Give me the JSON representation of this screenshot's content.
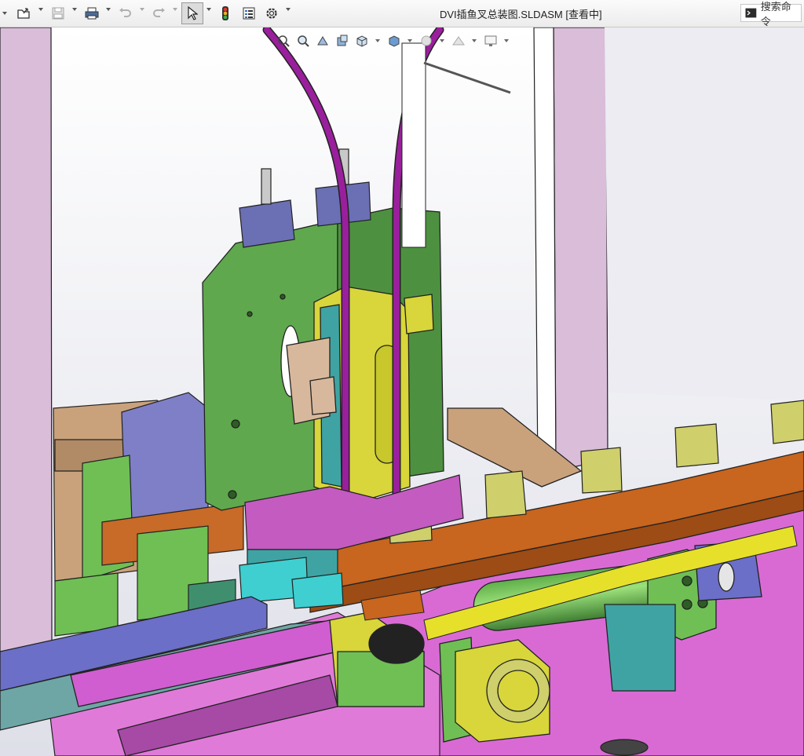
{
  "window": {
    "title": "DVI插鱼叉总装图.SLDASM [查看中]"
  },
  "toolbar": {
    "items": [
      {
        "name": "menu-arrow",
        "icon": "dropdown-arrow"
      },
      {
        "name": "open",
        "icon": "open-folder-icon"
      },
      {
        "name": "save",
        "icon": "save-icon"
      },
      {
        "name": "print",
        "icon": "print-icon"
      },
      {
        "name": "undo",
        "icon": "undo-icon"
      },
      {
        "name": "redo",
        "icon": "redo-icon"
      },
      {
        "name": "select",
        "icon": "cursor-icon"
      },
      {
        "name": "rebuild",
        "icon": "traffic-light-icon"
      },
      {
        "name": "file-properties",
        "icon": "properties-icon"
      },
      {
        "name": "options",
        "icon": "gear-icon"
      }
    ]
  },
  "search": {
    "label": "搜索命令",
    "icon": "search-command-icon"
  },
  "headsup_view": {
    "items": [
      "zoom-to-fit-icon",
      "zoom-area-icon",
      "previous-view-icon",
      "section-view-icon",
      "view-orientation-icon",
      "display-style-icon",
      "hide-show-icon",
      "appearance-icon",
      "scene-icon",
      "display-settings-icon"
    ]
  },
  "colors": {
    "background_top": "#ffffff",
    "background_bottom": "#e6e6ee",
    "green_plate": "#5fa84e",
    "yellow_part": "#d8d63a",
    "orange_rail": "#c8651e",
    "magenta_base": "#d95fd0",
    "purple_tube": "#9a1f9c",
    "teal_part": "#3fa3a3",
    "pink_frame": "#d9bdd9"
  }
}
